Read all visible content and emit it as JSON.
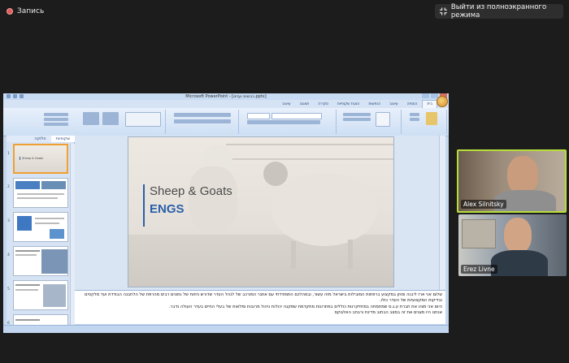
{
  "recording": {
    "label": "Запись",
    "icon": "record-icon"
  },
  "exit_fullscreen": {
    "label": "Выйти из полноэкранного режима",
    "icon": "exit-fullscreen-icon"
  },
  "powerpoint": {
    "window_title": "Microsoft PowerPoint - [כבשים ועזים.pptx]",
    "ribbon_tabs": [
      "בית",
      "הוספה",
      "עיצוב",
      "הנפשות",
      "הצגת שקופיות",
      "סקירה",
      "תצוגה",
      "עיצוב"
    ],
    "thumbnail_tabs": [
      "שקופיות",
      "חלוקה"
    ],
    "thumbnails": [
      {
        "number": "1",
        "text": "Sheep & Goats"
      },
      {
        "number": "2",
        "text": ""
      },
      {
        "number": "3",
        "text": ""
      },
      {
        "number": "4",
        "text": ""
      },
      {
        "number": "5",
        "text": ""
      },
      {
        "number": "6",
        "text": ""
      }
    ],
    "slide": {
      "title": "Sheep & Goats",
      "subtitle": "ENGS"
    },
    "notes": [
      "שלום אני ארז ליבנה ומחן במקצוע ברפתות המובילות בישראל מזה עשור, ובמהלכם התמודדתי עם אתגר המורכב של לנהל העדר שדורש ניתוח של נתונים רבים מהרפת של הלחבנה הבודדת ועד מלקטים ובדיקות המקצועיות של העדר כולו.",
      "היום אני מציג את חברת ע.ג.ס שמתמחה במחזיקרנות כוללים בפתרונות מתקדמת שמקנה יכולות ניהול מרובות ומלאות של בעלי החיים בעדר העולה נדבר.",
      "אנחנו היו מצגים את זה במצב הבחוב מדינת ורבחב האלגוקס"
    ]
  },
  "participants": [
    {
      "name": "Alex Silnitsky",
      "active_speaker": true
    },
    {
      "name": "Erez Livne",
      "active_speaker": false
    }
  ],
  "colors": {
    "active_speaker_border": "#b7df3a",
    "slide_accent": "#2a5fa9",
    "record_dot": "#e35b5b"
  }
}
